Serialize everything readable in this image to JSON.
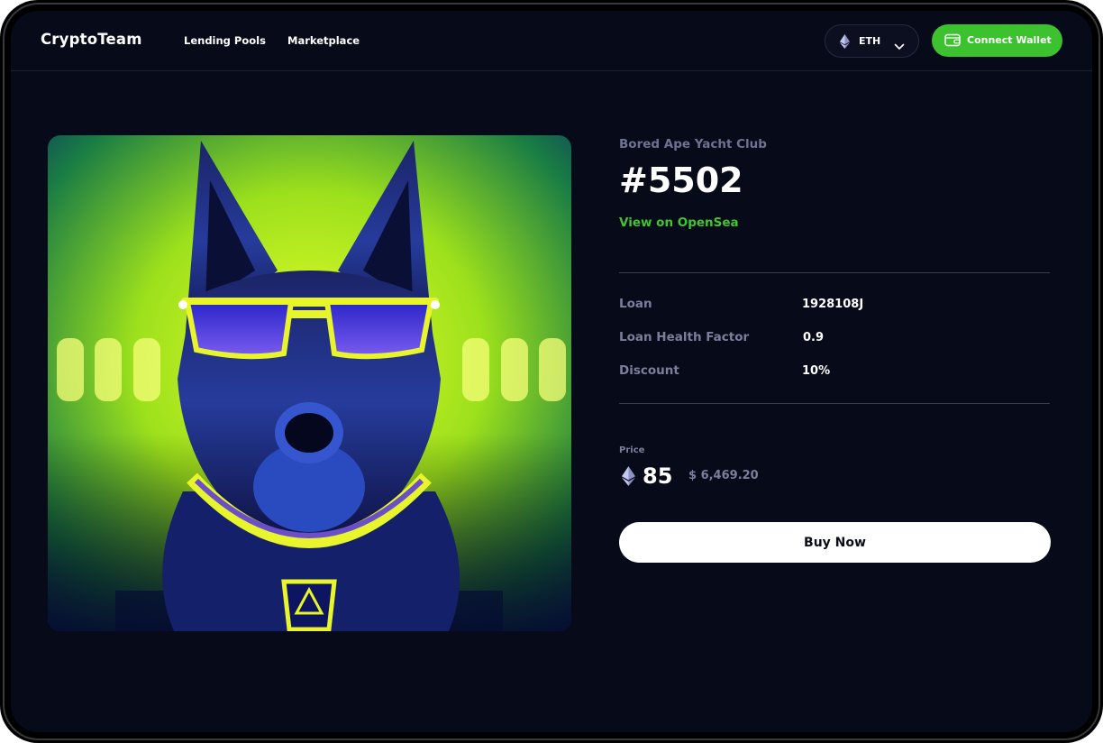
{
  "header": {
    "logo": "CryptoTeam",
    "nav": [
      "Lending Pools",
      "Marketplace"
    ],
    "chain": "ETH",
    "connect_label": "Connect Wallet"
  },
  "nft": {
    "collection": "Bored Ape Yacht Club",
    "token_id": "#5502",
    "opensea_link": "View on OpenSea",
    "artwork_subject": "german shepherd dog wearing yellow sunglasses and gold chain collar, neon yellow background"
  },
  "stats": [
    {
      "label": "Loan",
      "value": "1928108J"
    },
    {
      "label": "Loan Health Factor",
      "value": "0.9"
    },
    {
      "label": "Discount",
      "value": "10%"
    }
  ],
  "price": {
    "label": "Price",
    "eth": "85",
    "usd": "$ 6,469.20"
  },
  "buy_label": "Buy Now",
  "colors": {
    "background": "#070a19",
    "accent": "#3cc22e",
    "link": "#3fc52f",
    "muted_text": "#7b7f9c"
  },
  "icons": [
    "ethereum-icon",
    "chevron-down-icon",
    "wallet-icon"
  ]
}
